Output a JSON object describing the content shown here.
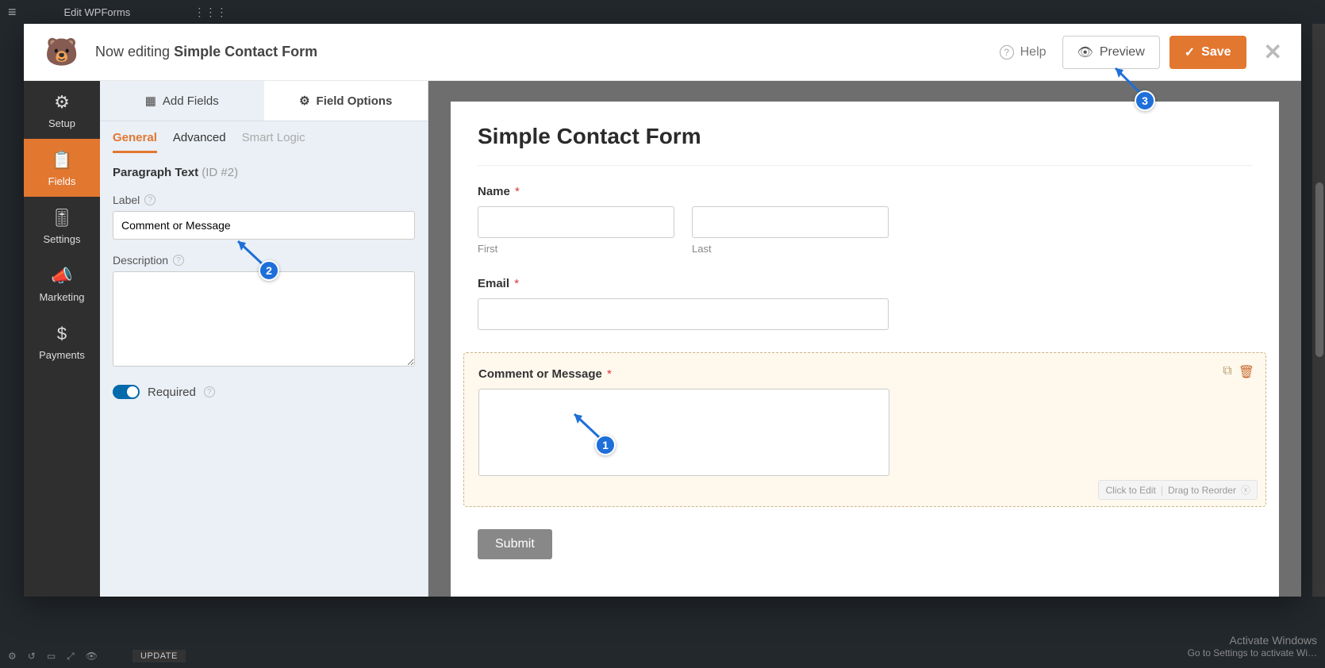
{
  "wp": {
    "breadcrumb": "Edit WPForms",
    "update_btn": "UPDATE",
    "activate_title": "Activate Windows",
    "activate_sub": "Go to Settings to activate Wi…"
  },
  "header": {
    "now_editing": "Now editing",
    "form_name": "Simple Contact Form",
    "help": "Help",
    "preview": "Preview",
    "save": "Save"
  },
  "leftnav": {
    "setup": "Setup",
    "fields": "Fields",
    "settings": "Settings",
    "marketing": "Marketing",
    "payments": "Payments"
  },
  "panel": {
    "tab_add": "Add Fields",
    "tab_options": "Field Options",
    "subtab_general": "General",
    "subtab_advanced": "Advanced",
    "subtab_smart": "Smart Logic",
    "field_title": "Paragraph Text",
    "field_id": "(ID #2)",
    "label_label": "Label",
    "label_value": "Comment or Message",
    "description_label": "Description",
    "description_value": "",
    "required_label": "Required"
  },
  "preview": {
    "title": "Simple Contact Form",
    "name_label": "Name",
    "first_sub": "First",
    "last_sub": "Last",
    "email_label": "Email",
    "selected_label": "Comment or Message",
    "hint_edit": "Click to Edit",
    "hint_drag": "Drag to Reorder",
    "submit": "Submit"
  },
  "steps": {
    "s1": "1",
    "s2": "2",
    "s3": "3"
  }
}
